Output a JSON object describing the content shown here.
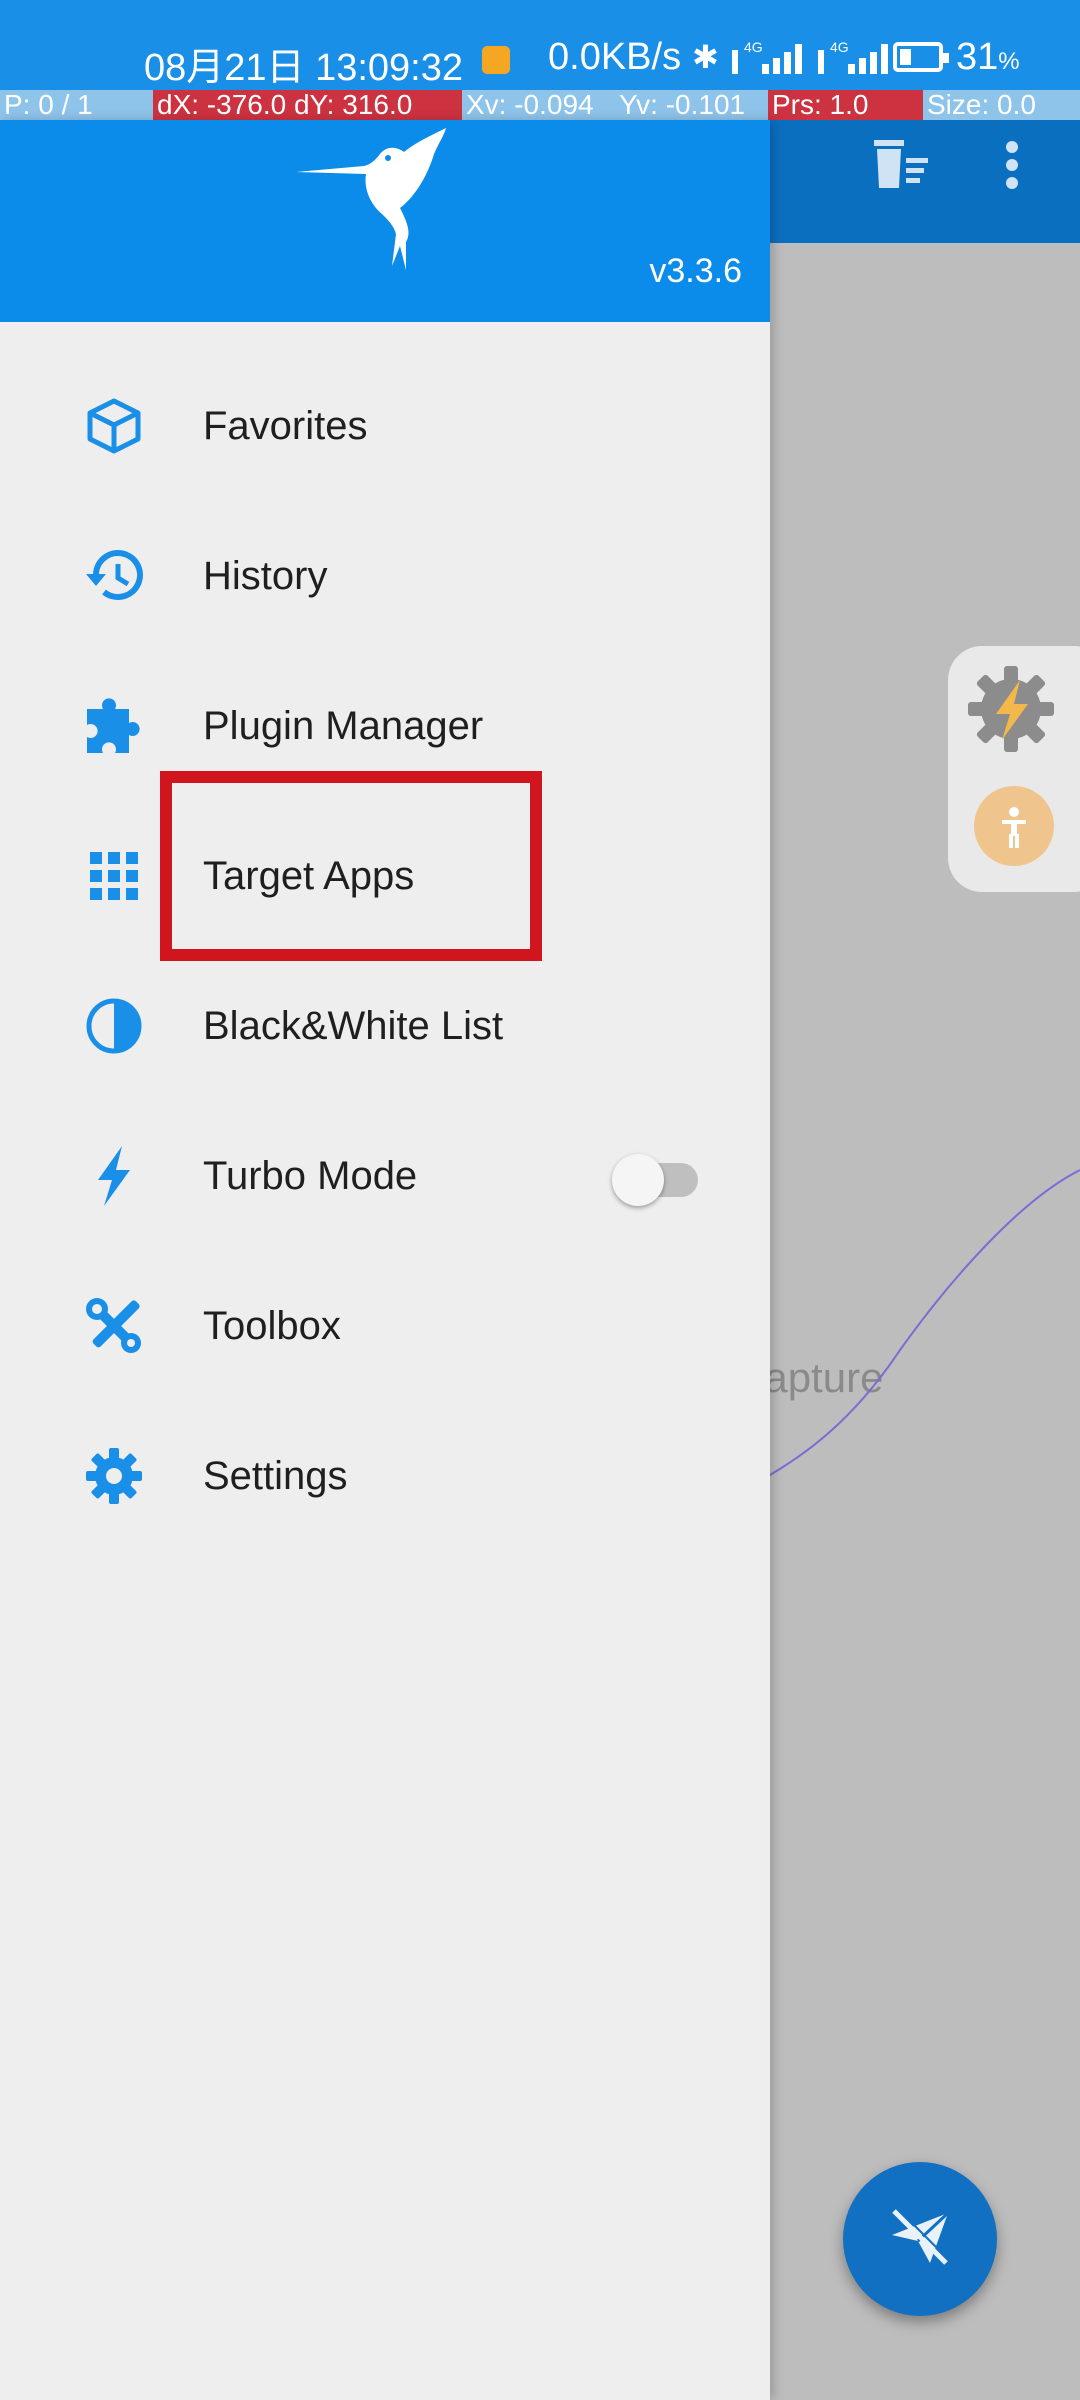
{
  "status_bar": {
    "time": "08月21日 13:09:32",
    "net_speed": "0.0KB/s",
    "signal_1": "4G",
    "signal_2": "4G",
    "battery_value": "31",
    "battery_unit": "%",
    "battery_fraction": 0.31
  },
  "pointer_overlay": {
    "p": "P: 0 / 1",
    "dxy": "dX: -376.0  dY: 316.0",
    "xv": "Xv: -0.094",
    "yv": "Yv: -0.101",
    "prs": "Prs: 1.0",
    "size": "Size: 0.0"
  },
  "drawer": {
    "version": "v3.3.6",
    "items": [
      {
        "label": "Favorites",
        "icon": "cube-icon"
      },
      {
        "label": "History",
        "icon": "history-icon"
      },
      {
        "label": "Plugin Manager",
        "icon": "puzzle-icon"
      },
      {
        "label": "Target Apps",
        "icon": "grid-icon"
      },
      {
        "label": "Black&White List",
        "icon": "half-circle-icon"
      },
      {
        "label": "Turbo Mode",
        "icon": "lightning-icon",
        "toggle_on": false
      },
      {
        "label": "Toolbox",
        "icon": "tools-icon"
      },
      {
        "label": "Settings",
        "icon": "gear-icon"
      }
    ]
  },
  "background": {
    "hint_text": "t capture"
  },
  "colors": {
    "accent": "#0b8ceb",
    "icon": "#1a8fe8",
    "highlight": "#d0151f"
  }
}
